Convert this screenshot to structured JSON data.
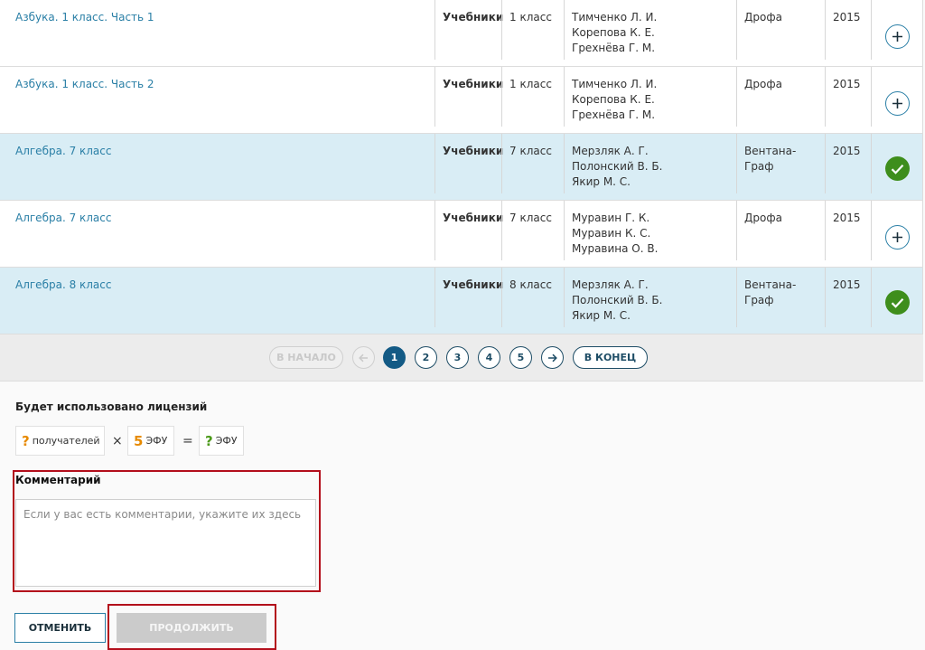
{
  "rows": [
    {
      "title": "Азбука. 1 класс. Часть 1",
      "type": "Учебники",
      "grade": "1 класс",
      "authors": [
        "Тимченко Л. И.",
        "Корепова К. Е.",
        "Грехнёва Г. М."
      ],
      "publisher": "Дрофа",
      "year": "2015",
      "selected": false,
      "action_icon": "plus-icon"
    },
    {
      "title": "Азбука. 1 класс. Часть 2",
      "type": "Учебники",
      "grade": "1 класс",
      "authors": [
        "Тимченко Л. И.",
        "Корепова К. Е.",
        "Грехнёва Г. М."
      ],
      "publisher": "Дрофа",
      "year": "2015",
      "selected": false,
      "action_icon": "plus-icon"
    },
    {
      "title": "Алгебра. 7 класс",
      "type": "Учебники",
      "grade": "7 класс",
      "authors": [
        "Мерзляк А. Г.",
        "Полонский В. Б.",
        "Якир М. С."
      ],
      "publisher": "Вентана-Граф",
      "year": "2015",
      "selected": true,
      "action_icon": "check-icon"
    },
    {
      "title": "Алгебра. 7 класс",
      "type": "Учебники",
      "grade": "7 класс",
      "authors": [
        "Муравин Г. К.",
        "Муравин К. С.",
        "Муравина О. В."
      ],
      "publisher": "Дрофа",
      "year": "2015",
      "selected": false,
      "action_icon": "plus-icon"
    },
    {
      "title": "Алгебра. 8 класс",
      "type": "Учебники",
      "grade": "8 класс",
      "authors": [
        "Мерзляк А. Г.",
        "Полонский В. Б.",
        "Якир М. С."
      ],
      "publisher": "Вентана-Граф",
      "year": "2015",
      "selected": true,
      "action_icon": "check-icon"
    }
  ],
  "pagination": {
    "first_label": "В НАЧАЛО",
    "last_label": "В КОНЕЦ",
    "pages": [
      "1",
      "2",
      "3",
      "4",
      "5"
    ],
    "current_page": "1",
    "prev_icon": "arrow-left-icon",
    "next_icon": "arrow-right-icon"
  },
  "licenses": {
    "title": "Будет использовано лицензий",
    "recipients_value": "?",
    "recipients_label": "получателей",
    "times_sign": "×",
    "efu_value": "5",
    "efu_label": "ЭФУ",
    "equals_sign": "=",
    "total_value": "?",
    "total_label": "ЭФУ"
  },
  "comment": {
    "label": "Комментарий",
    "placeholder": "Если у вас есть комментарии, укажите их здесь"
  },
  "actions": {
    "cancel_label": "ОТМЕНИТЬ",
    "continue_label": "ПРОДОЛЖИТЬ"
  },
  "colors": {
    "link": "#2a7fa6",
    "selected_row": "#d9edf5",
    "check_green": "#3e8e1c",
    "active_page": "#135a85",
    "highlight_frame": "#b30e1b"
  }
}
